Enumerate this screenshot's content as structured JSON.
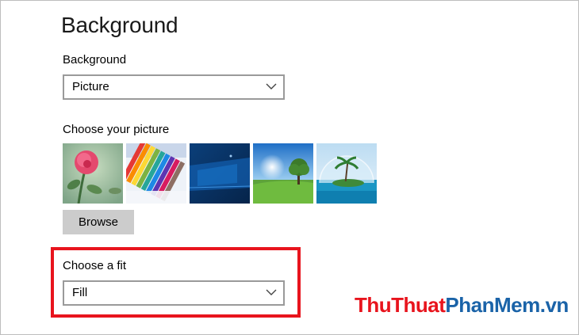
{
  "page": {
    "title": "Background"
  },
  "background": {
    "label": "Background",
    "selected": "Picture"
  },
  "picture": {
    "label": "Choose your picture",
    "thumbnails": [
      "rose-picture",
      "colored-pencils-picture",
      "blue-windows-picture",
      "tree-field-picture",
      "island-bubble-picture"
    ],
    "browse_label": "Browse"
  },
  "fit": {
    "label": "Choose a fit",
    "selected": "Fill"
  },
  "colors": {
    "highlight": "#e8141d",
    "watermark_red": "#e8141d",
    "watermark_blue": "#1a63a8",
    "button_bg": "#cccccc",
    "select_border": "#9a9a9a"
  },
  "watermark": {
    "part1": "ThuThuat",
    "part2": "PhanMem",
    "part3": ".vn"
  }
}
